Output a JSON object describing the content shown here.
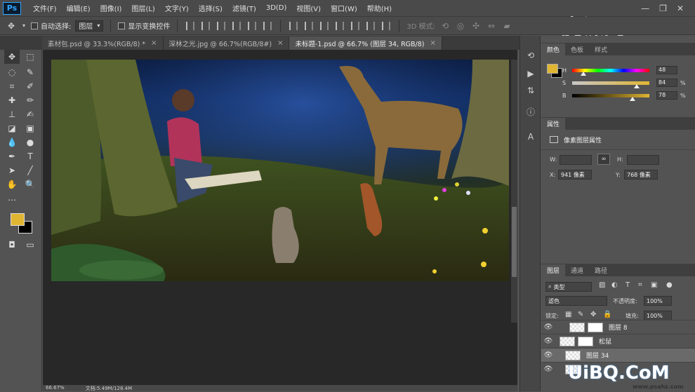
{
  "app": {
    "logo": "Ps"
  },
  "menubar": {
    "items": [
      "文件(F)",
      "编辑(E)",
      "图像(I)",
      "图层(L)",
      "文字(Y)",
      "选择(S)",
      "滤镜(T)",
      "3D(D)",
      "视图(V)",
      "窗口(W)",
      "帮助(H)"
    ],
    "window_controls": [
      "—",
      "❐",
      "✕"
    ]
  },
  "options": {
    "auto_select_label": "自动选择:",
    "auto_select_value": "图层",
    "show_transform_label": "显示变换控件",
    "mode_3d_label": "3D 模式:"
  },
  "tabs": [
    {
      "label": "素材包.psd @ 33.3%(RGB/8) *",
      "active": false
    },
    {
      "label": "深林之光.jpg @ 66.7%(RGB/8#)",
      "active": false
    },
    {
      "label": "未标题-1.psd @ 66.7% (图层 34, RGB/8)",
      "active": true
    }
  ],
  "status": {
    "zoom": "66.67%",
    "doc": "文档:5.49M/128.4M"
  },
  "colors": {
    "foreground": "#e0b531",
    "background": "#000000"
  },
  "color_panel": {
    "tabs": [
      "颜色",
      "色板",
      "样式"
    ],
    "h_label": "H",
    "h_value": "48",
    "s_label": "S",
    "s_value": "84",
    "s_unit": "%",
    "b_label": "B",
    "b_value": "78",
    "b_unit": "%"
  },
  "properties_panel": {
    "title": "属性",
    "subtitle": "像素图层属性",
    "w_label": "W:",
    "h_label": "H:",
    "x_label": "X:",
    "x_value": "941 像素",
    "y_label": "Y:",
    "y_value": "768 像素"
  },
  "layers_panel": {
    "tabs": [
      "图层",
      "通道",
      "路径"
    ],
    "filter_kind": "类型",
    "blend_mode": "滤色",
    "opacity_label": "不透明度:",
    "opacity_value": "100%",
    "lock_label": "锁定:",
    "fill_label": "填充:",
    "fill_value": "100%",
    "layers": [
      {
        "name": "图层 8",
        "selected": false
      },
      {
        "name": "松鼠",
        "selected": false
      },
      {
        "name": "图层 34",
        "selected": true
      },
      {
        "name": "",
        "selected": false
      }
    ]
  },
  "watermarks": {
    "top": "虎课网",
    "bottom": "UiBQ.CoM",
    "bottom_small": "www.psahz.com"
  },
  "tools": {
    "move": "move-tool"
  }
}
